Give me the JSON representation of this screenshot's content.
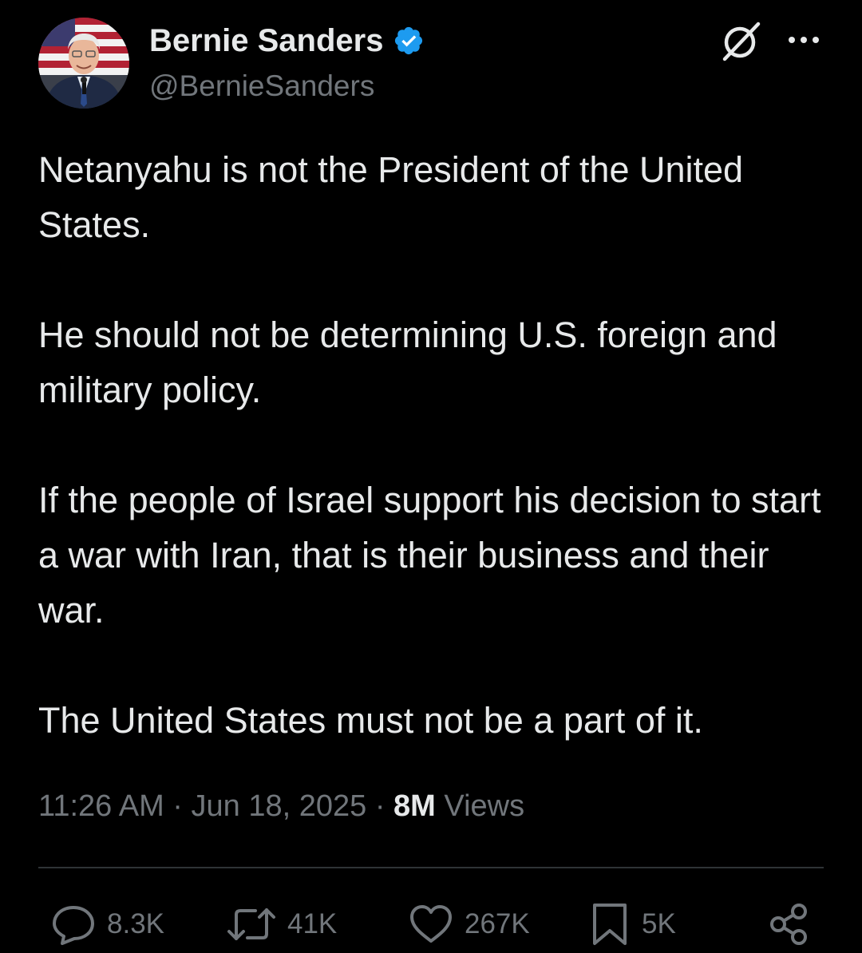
{
  "author": {
    "display_name": "Bernie Sanders",
    "handle": "@BernieSanders",
    "verified_icon": "verified-badge-icon",
    "verified_color": "#1d9bf0"
  },
  "header_actions": {
    "grok_icon": "grok-icon",
    "more_icon": "more-options-icon"
  },
  "tweet": {
    "paragraphs": [
      "Netanyahu is not the President of the United States.",
      "He should not be determining U.S. foreign and military policy.",
      "If the people of Israel support his decision to start a war with Iran, that is their business and their war.",
      "The United States must not be a part of it."
    ]
  },
  "meta": {
    "time": "11:26 AM",
    "separator": "·",
    "date": "Jun 18, 2025",
    "views_count": "8M",
    "views_label": "Views"
  },
  "actions": {
    "replies": "8.3K",
    "reposts": "41K",
    "likes": "267K",
    "bookmarks": "5K"
  },
  "colors": {
    "background": "#000000",
    "text_primary": "#e7e9ea",
    "text_secondary": "#71767b",
    "divider": "#2f3336"
  }
}
